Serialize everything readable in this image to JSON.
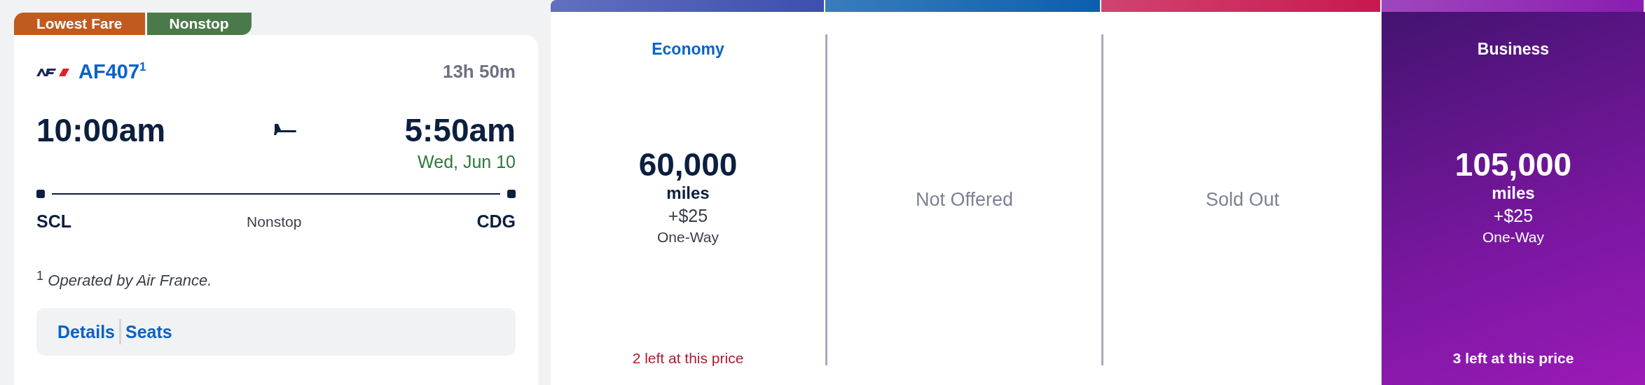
{
  "badges": [
    {
      "label": "Lowest Fare",
      "color": "#c05a1f"
    },
    {
      "label": "Nonstop",
      "color": "#4a7a49"
    }
  ],
  "flight": {
    "number": "AF407",
    "footnote_mark": "1",
    "duration": "13h 50m",
    "depart_time": "10:00am",
    "arrive_time": "5:50am",
    "arrive_date": "Wed, Jun 10",
    "origin": "SCL",
    "stops": "Nonstop",
    "destination": "CDG",
    "footnote": "$^{1}$ *Operated by Air France.*"
  },
  "links": [
    "Details",
    "Seats"
  ],
  "fares": [
    {
      "kind": "price",
      "selected": false,
      "color": "#3d4fb0",
      "title": "Economy",
      "miles": "60,000",
      "unit": "miles",
      "fee": "+$25",
      "trip": "One-Way",
      "availability": "2 left at this price"
    },
    {
      "kind": "unavailable",
      "selected": false,
      "color": "#0b5fae",
      "status": "Not Offered"
    },
    {
      "kind": "unavailable",
      "selected": false,
      "color": "#c8184f",
      "status": "Sold Out"
    },
    {
      "kind": "price",
      "selected": true,
      "color": "#8a1cb0",
      "title": "Business",
      "miles": "105,000",
      "unit": "miles",
      "fee": "+$25",
      "trip": "One-Way",
      "availability": "3 left at this price"
    }
  ]
}
